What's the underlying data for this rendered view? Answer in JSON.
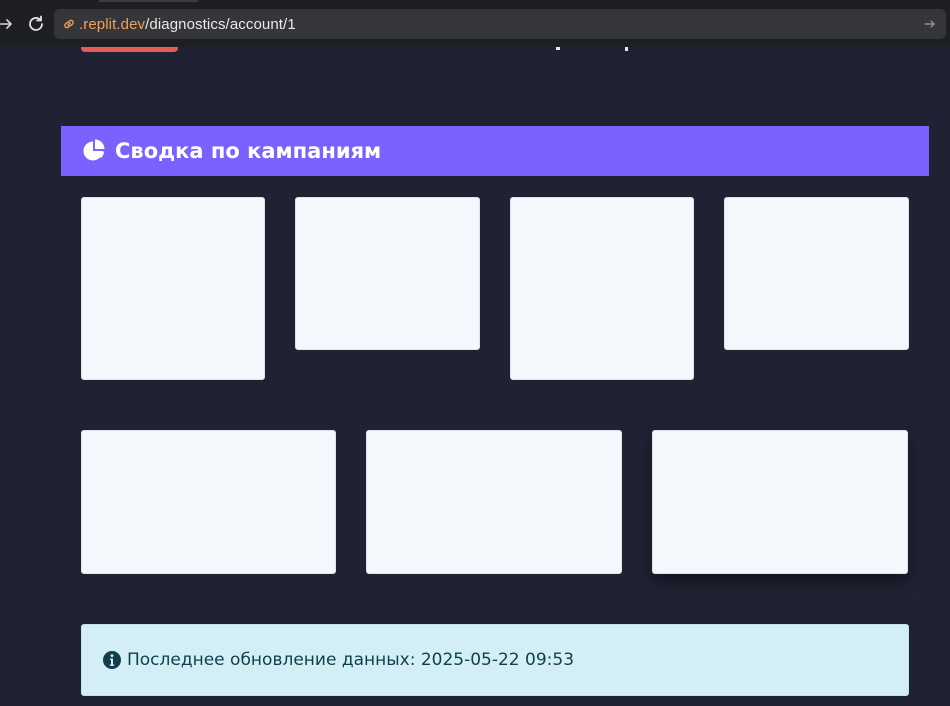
{
  "browser": {
    "url_domain": ".replit.dev",
    "url_path": "/diagnostics/account/1"
  },
  "section": {
    "title": "Сводка по кампаниям",
    "icon": "chart-pie-icon",
    "accent_color": "#7b61ff"
  },
  "cards": [
    {
      "id": "card-1"
    },
    {
      "id": "card-2"
    },
    {
      "id": "card-3"
    },
    {
      "id": "card-4"
    },
    {
      "id": "card-5"
    },
    {
      "id": "card-6"
    },
    {
      "id": "card-7"
    }
  ],
  "info": {
    "icon": "info-circle-icon",
    "text": "Последнее обновление данных: 2025-05-22 09:53"
  },
  "colors": {
    "page_bg": "#1e2232",
    "card_bg": "#f4f7fb",
    "info_bg": "#d3eff5",
    "top_button": "#e65a5a"
  }
}
